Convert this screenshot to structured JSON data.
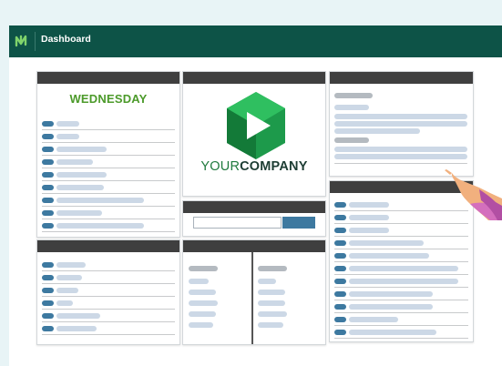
{
  "header": {
    "title": "Dashboard",
    "logo_icon": "logo-n-icon",
    "brand_color": "#0d5347"
  },
  "calendar_panel": {
    "day": "WEDNESDAY",
    "row_count": 9
  },
  "logo_panel": {
    "brand_prefix": "YOUR",
    "brand_suffix": "COMPANY",
    "play_icon": "play-logo-icon"
  },
  "search_panel": {
    "placeholder": "",
    "button_icon": "search-button"
  },
  "colors": {
    "accent": "#3d79a0",
    "placeholder_bar": "#ccd8e6",
    "panel_header": "#3f3f3f",
    "day_label": "#4c9a2a"
  }
}
